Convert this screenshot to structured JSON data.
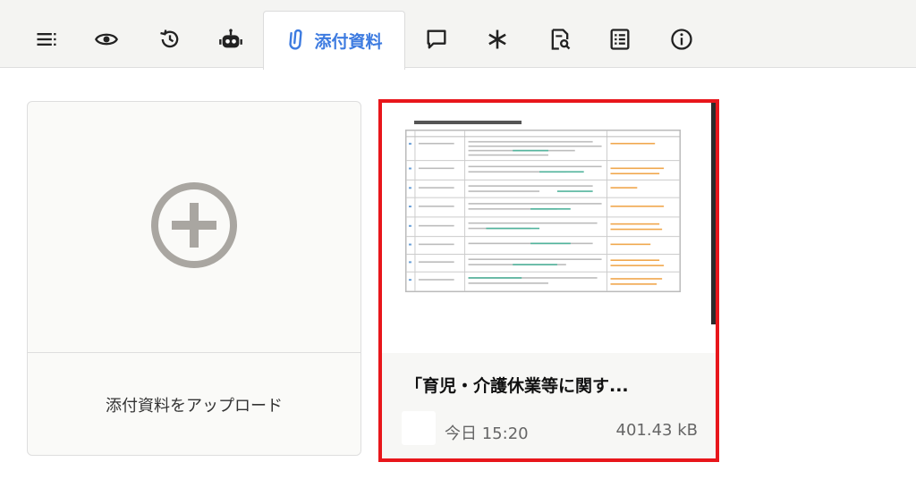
{
  "toolbar": {
    "icons": [
      "list-icon",
      "eye-icon",
      "history-icon",
      "robot-icon",
      "chat-icon",
      "asterisk-icon",
      "document-search-icon",
      "checklist-icon",
      "info-icon"
    ],
    "active_tab": {
      "label": "添付資料",
      "icon": "paperclip-icon"
    },
    "accent_color": "#3d7be0"
  },
  "upload": {
    "label": "添付資料をアップロード",
    "icon": "plus-circle-icon"
  },
  "file": {
    "name": "「育児・介護休業等に関す...",
    "time": "今日 15:20",
    "size": "401.43 kB",
    "highlight_color": "#e8161b"
  }
}
